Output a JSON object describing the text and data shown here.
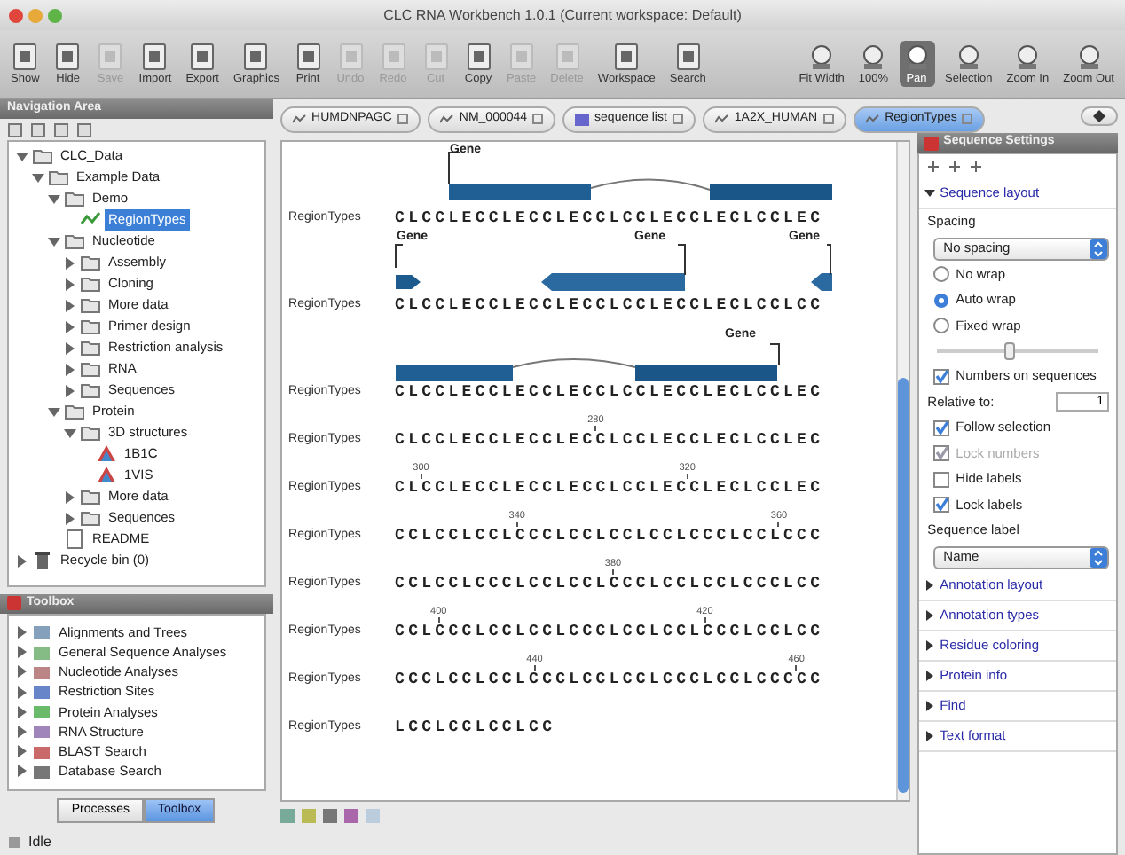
{
  "window": {
    "title": "CLC RNA Workbench 1.0.1 (Current workspace: Default)"
  },
  "toolbar": {
    "left": [
      {
        "label": "Show",
        "disabled": false
      },
      {
        "label": "Hide",
        "disabled": false
      },
      {
        "label": "Save",
        "disabled": true
      },
      {
        "label": "Import",
        "disabled": false
      },
      {
        "label": "Export",
        "disabled": false
      },
      {
        "label": "Graphics",
        "disabled": false
      },
      {
        "label": "Print",
        "disabled": false
      },
      {
        "label": "Undo",
        "disabled": true
      },
      {
        "label": "Redo",
        "disabled": true
      },
      {
        "label": "Cut",
        "disabled": true
      },
      {
        "label": "Copy",
        "disabled": false
      },
      {
        "label": "Paste",
        "disabled": true
      },
      {
        "label": "Delete",
        "disabled": true
      },
      {
        "label": "Workspace",
        "disabled": false
      },
      {
        "label": "Search",
        "disabled": false
      }
    ],
    "right": [
      {
        "label": "Fit Width",
        "selected": false
      },
      {
        "label": "100%",
        "selected": false
      },
      {
        "label": "Pan",
        "selected": true
      },
      {
        "label": "Selection",
        "selected": false
      },
      {
        "label": "Zoom In",
        "selected": false
      },
      {
        "label": "Zoom Out",
        "selected": false
      }
    ]
  },
  "navigation": {
    "title": "Navigation Area",
    "tree": [
      {
        "label": "CLC_Data",
        "kind": "folder",
        "expanded": true,
        "selected": false,
        "children": [
          {
            "label": "Example Data",
            "kind": "folder",
            "expanded": true,
            "selected": false,
            "children": [
              {
                "label": "Demo",
                "kind": "folder",
                "expanded": true,
                "selected": false,
                "children": [
                  {
                    "label": "RegionTypes",
                    "kind": "sequence",
                    "selected": true
                  }
                ]
              },
              {
                "label": "Nucleotide",
                "kind": "folder",
                "expanded": true,
                "selected": false,
                "children": [
                  {
                    "label": "Assembly",
                    "kind": "folder",
                    "expanded": false,
                    "selected": false
                  },
                  {
                    "label": "Cloning",
                    "kind": "folder",
                    "expanded": false,
                    "selected": false
                  },
                  {
                    "label": "More data",
                    "kind": "folder",
                    "expanded": false,
                    "selected": false
                  },
                  {
                    "label": "Primer design",
                    "kind": "folder",
                    "expanded": false,
                    "selected": false
                  },
                  {
                    "label": "Restriction analysis",
                    "kind": "folder",
                    "expanded": false,
                    "selected": false
                  },
                  {
                    "label": "RNA",
                    "kind": "folder",
                    "expanded": false,
                    "selected": false
                  },
                  {
                    "label": "Sequences",
                    "kind": "folder",
                    "expanded": false,
                    "selected": false
                  }
                ]
              },
              {
                "label": "Protein",
                "kind": "folder",
                "expanded": true,
                "selected": false,
                "children": [
                  {
                    "label": "3D structures",
                    "kind": "folder",
                    "expanded": true,
                    "selected": false,
                    "children": [
                      {
                        "label": "1B1C",
                        "kind": "structure",
                        "selected": false
                      },
                      {
                        "label": "1VIS",
                        "kind": "structure",
                        "selected": false
                      }
                    ]
                  },
                  {
                    "label": "More data",
                    "kind": "folder",
                    "expanded": false,
                    "selected": false
                  },
                  {
                    "label": "Sequences",
                    "kind": "folder",
                    "expanded": false,
                    "selected": false
                  }
                ]
              },
              {
                "label": "README",
                "kind": "file",
                "selected": false
              }
            ]
          }
        ]
      },
      {
        "label": "Recycle bin (0)",
        "kind": "trash",
        "expanded": false,
        "selected": false
      }
    ]
  },
  "toolbox": {
    "title": "Toolbox",
    "items": [
      {
        "label": "Alignments and Trees"
      },
      {
        "label": "General Sequence Analyses"
      },
      {
        "label": "Nucleotide Analyses"
      },
      {
        "label": "Restriction Sites"
      },
      {
        "label": "Protein Analyses"
      },
      {
        "label": "RNA Structure"
      },
      {
        "label": "BLAST Search"
      },
      {
        "label": "Database Search"
      }
    ],
    "buttons": [
      {
        "label": "Processes",
        "selected": false
      },
      {
        "label": "Toolbox",
        "selected": true
      }
    ]
  },
  "status_bar": {
    "text": "Idle"
  },
  "tabs": [
    {
      "label": "HUMDNPAGC",
      "kind": "sequence",
      "selected": false
    },
    {
      "label": "NM_000044",
      "kind": "sequence",
      "selected": false
    },
    {
      "label": "sequence list",
      "kind": "list",
      "selected": false
    },
    {
      "label": "1A2X_HUMAN",
      "kind": "sequence",
      "selected": false
    },
    {
      "label": "RegionTypes",
      "kind": "sequence",
      "selected": true
    }
  ],
  "sequence_view": {
    "rows": [
      {
        "label": "RegionTypes",
        "sequence": "CLCCLECCLECCLECCLCCLECCLECLCCLEC",
        "kind": "spliced",
        "annotations": [
          "Gene"
        ],
        "ticks": []
      },
      {
        "label": "RegionTypes",
        "sequence": "CLCCLECCLECCLECCLCCLECCLECLCCLCC",
        "kind": "arrows",
        "annotations": [
          "Gene",
          "Gene",
          "Gene"
        ],
        "ticks": []
      },
      {
        "label": "RegionTypes",
        "sequence": "CLCCLECCLECCLECCLCCLECCLECLCCLEC",
        "kind": "spliced-end",
        "annotations": [
          "Gene"
        ],
        "ticks": []
      },
      {
        "label": "RegionTypes",
        "sequence": "CLCCLECCLECCLECCLCCLECCLECLCCLEC",
        "kind": "plain",
        "annotations": [],
        "ticks": [
          "280"
        ]
      },
      {
        "label": "RegionTypes",
        "sequence": "CLCCLECCLECCLECCLCCLECCLECLCCLEC",
        "kind": "plain",
        "annotations": [],
        "ticks": [
          "300",
          "320"
        ]
      },
      {
        "label": "RegionTypes",
        "sequence": "CCLCCLCCLCCCLCCLCCLCCLCCCLCCLCCC",
        "kind": "plain",
        "annotations": [],
        "ticks": [
          "340",
          "360"
        ]
      },
      {
        "label": "RegionTypes",
        "sequence": "CCLCCLCCCLCCLCCLCCCLCCLCCLCCCLCC",
        "kind": "plain",
        "annotations": [],
        "ticks": [
          "380"
        ]
      },
      {
        "label": "RegionTypes",
        "sequence": "CCLCCCLCCLCCLCCCLCCLCCLCCCLCCLCC",
        "kind": "plain",
        "annotations": [],
        "ticks": [
          "400",
          "420"
        ]
      },
      {
        "label": "RegionTypes",
        "sequence": "CCCLCCLCCLCCCLCCLCCLCCCLCCLCCCCC",
        "kind": "plain",
        "annotations": [],
        "ticks": [
          "440",
          "460"
        ]
      },
      {
        "label": "RegionTypes",
        "sequence": "LCCLCCLCCLCC",
        "kind": "plain",
        "annotations": [],
        "ticks": []
      }
    ]
  },
  "side_panel": {
    "title": "Sequence Settings",
    "sections": [
      {
        "title": "Sequence layout",
        "expanded": true,
        "controls": [
          {
            "kind": "label",
            "label": "Spacing"
          },
          {
            "kind": "select",
            "value": "No spacing"
          },
          {
            "kind": "radio",
            "label": "No wrap",
            "selected": false
          },
          {
            "kind": "radio",
            "label": "Auto wrap",
            "selected": true
          },
          {
            "kind": "radio",
            "label": "Fixed wrap",
            "selected": false
          },
          {
            "kind": "slider",
            "level": 0.45
          },
          {
            "kind": "checkbox",
            "label": "Numbers on sequences",
            "checked": true,
            "disabled": false
          },
          {
            "kind": "field",
            "label": "Relative to:",
            "value": "1"
          },
          {
            "kind": "checkbox",
            "label": "Follow selection",
            "checked": true,
            "disabled": false
          },
          {
            "kind": "checkbox",
            "label": "Lock numbers",
            "checked": true,
            "disabled": true
          },
          {
            "kind": "checkbox",
            "label": "Hide labels",
            "checked": false,
            "disabled": false
          },
          {
            "kind": "checkbox",
            "label": "Lock labels",
            "checked": true,
            "disabled": false
          },
          {
            "kind": "label",
            "label": "Sequence label"
          },
          {
            "kind": "select",
            "value": "Name"
          }
        ]
      },
      {
        "title": "Annotation layout",
        "expanded": false
      },
      {
        "title": "Annotation types",
        "expanded": false
      },
      {
        "title": "Residue coloring",
        "expanded": false
      },
      {
        "title": "Protein info",
        "expanded": false
      },
      {
        "title": "Find",
        "expanded": false
      },
      {
        "title": "Text format",
        "expanded": false
      }
    ]
  }
}
